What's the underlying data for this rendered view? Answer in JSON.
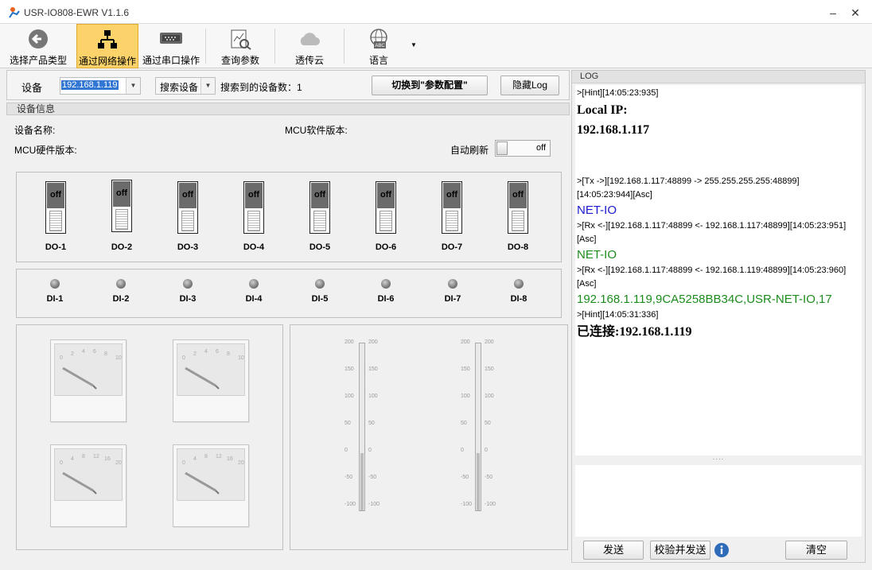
{
  "window": {
    "title": "USR-IO808-EWR V1.1.6"
  },
  "toolbar": {
    "items": [
      {
        "label": "选择产品类型",
        "icon": "back-arrow-icon"
      },
      {
        "label": "通过网络操作",
        "icon": "network-icon"
      },
      {
        "label": "通过串口操作",
        "icon": "serial-port-icon"
      },
      {
        "label": "查询参数",
        "icon": "query-chart-icon"
      },
      {
        "label": "透传云",
        "icon": "cloud-icon"
      },
      {
        "label": "语言",
        "icon": "globe-abc-icon"
      }
    ]
  },
  "devbar": {
    "device_label": "设备",
    "device_value": "192.168.1.119",
    "search_label": "搜索设备",
    "found_label": "搜索到的设备数：",
    "found_count": "1",
    "switch_button": "切换到\"参数配置\"",
    "hide_log_button": "隐藏Log"
  },
  "device_info": {
    "header": "设备信息",
    "name_label": "设备名称:",
    "mcu_sw_label": "MCU软件版本:",
    "mcu_hw_label": "MCU硬件版本:",
    "auto_refresh_label": "自动刷新",
    "auto_refresh_state": "off"
  },
  "do_switches": [
    {
      "label": "DO-1",
      "state": "off"
    },
    {
      "label": "DO-2",
      "state": "off"
    },
    {
      "label": "DO-3",
      "state": "off"
    },
    {
      "label": "DO-4",
      "state": "off"
    },
    {
      "label": "DO-5",
      "state": "off"
    },
    {
      "label": "DO-6",
      "state": "off"
    },
    {
      "label": "DO-7",
      "state": "off"
    },
    {
      "label": "DO-8",
      "state": "off"
    }
  ],
  "di_inputs": [
    "DI-1",
    "DI-2",
    "DI-3",
    "DI-4",
    "DI-5",
    "DI-6",
    "DI-7",
    "DI-8"
  ],
  "gauges": [
    {
      "ticks": [
        "0",
        "2",
        "4",
        "6",
        "8",
        "10"
      ]
    },
    {
      "ticks": [
        "0",
        "2",
        "4",
        "6",
        "8",
        "10"
      ]
    },
    {
      "ticks": [
        "0",
        "4",
        "8",
        "12",
        "16",
        "20"
      ]
    },
    {
      "ticks": [
        "0",
        "4",
        "8",
        "12",
        "16",
        "20"
      ]
    }
  ],
  "sliders": {
    "scale": [
      "200",
      "150",
      "100",
      "50",
      "0",
      "-50",
      "-100"
    ]
  },
  "log": {
    "header": "LOG",
    "lines": [
      {
        "style": "l-small",
        "text": ">[Hint][14:05:23:935]"
      },
      {
        "style": "l-big",
        "text": "Local IP:"
      },
      {
        "style": "l-big",
        "text": "192.168.1.117"
      },
      {
        "style": "l-small",
        "text": ">[Tx ->][192.168.1.117:48899 -> 255.255.255.255:48899]"
      },
      {
        "style": "l-small",
        "text": "[14:05:23:944][Asc]"
      },
      {
        "style": "l-blue",
        "text": "NET-IO"
      },
      {
        "style": "l-small",
        "text": ">[Rx <-][192.168.1.117:48899 <- 192.168.1.117:48899][14:05:23:951]"
      },
      {
        "style": "l-small",
        "text": "[Asc]"
      },
      {
        "style": "l-green",
        "text": "NET-IO"
      },
      {
        "style": "l-small",
        "text": ">[Rx <-][192.168.1.117:48899 <- 192.168.1.119:48899][14:05:23:960]"
      },
      {
        "style": "l-small",
        "text": "[Asc]"
      },
      {
        "style": "l-green",
        "text": "192.168.1.119,9CA5258BB34C,USR-NET-IO,17"
      },
      {
        "style": "l-small",
        "text": ">[Hint][14:05:31:336]"
      },
      {
        "style": "l-big",
        "text": "已连接:192.168.1.119"
      }
    ],
    "send_button": "发送",
    "checksum_send_button": "校验并发送",
    "clear_button": "清空"
  }
}
